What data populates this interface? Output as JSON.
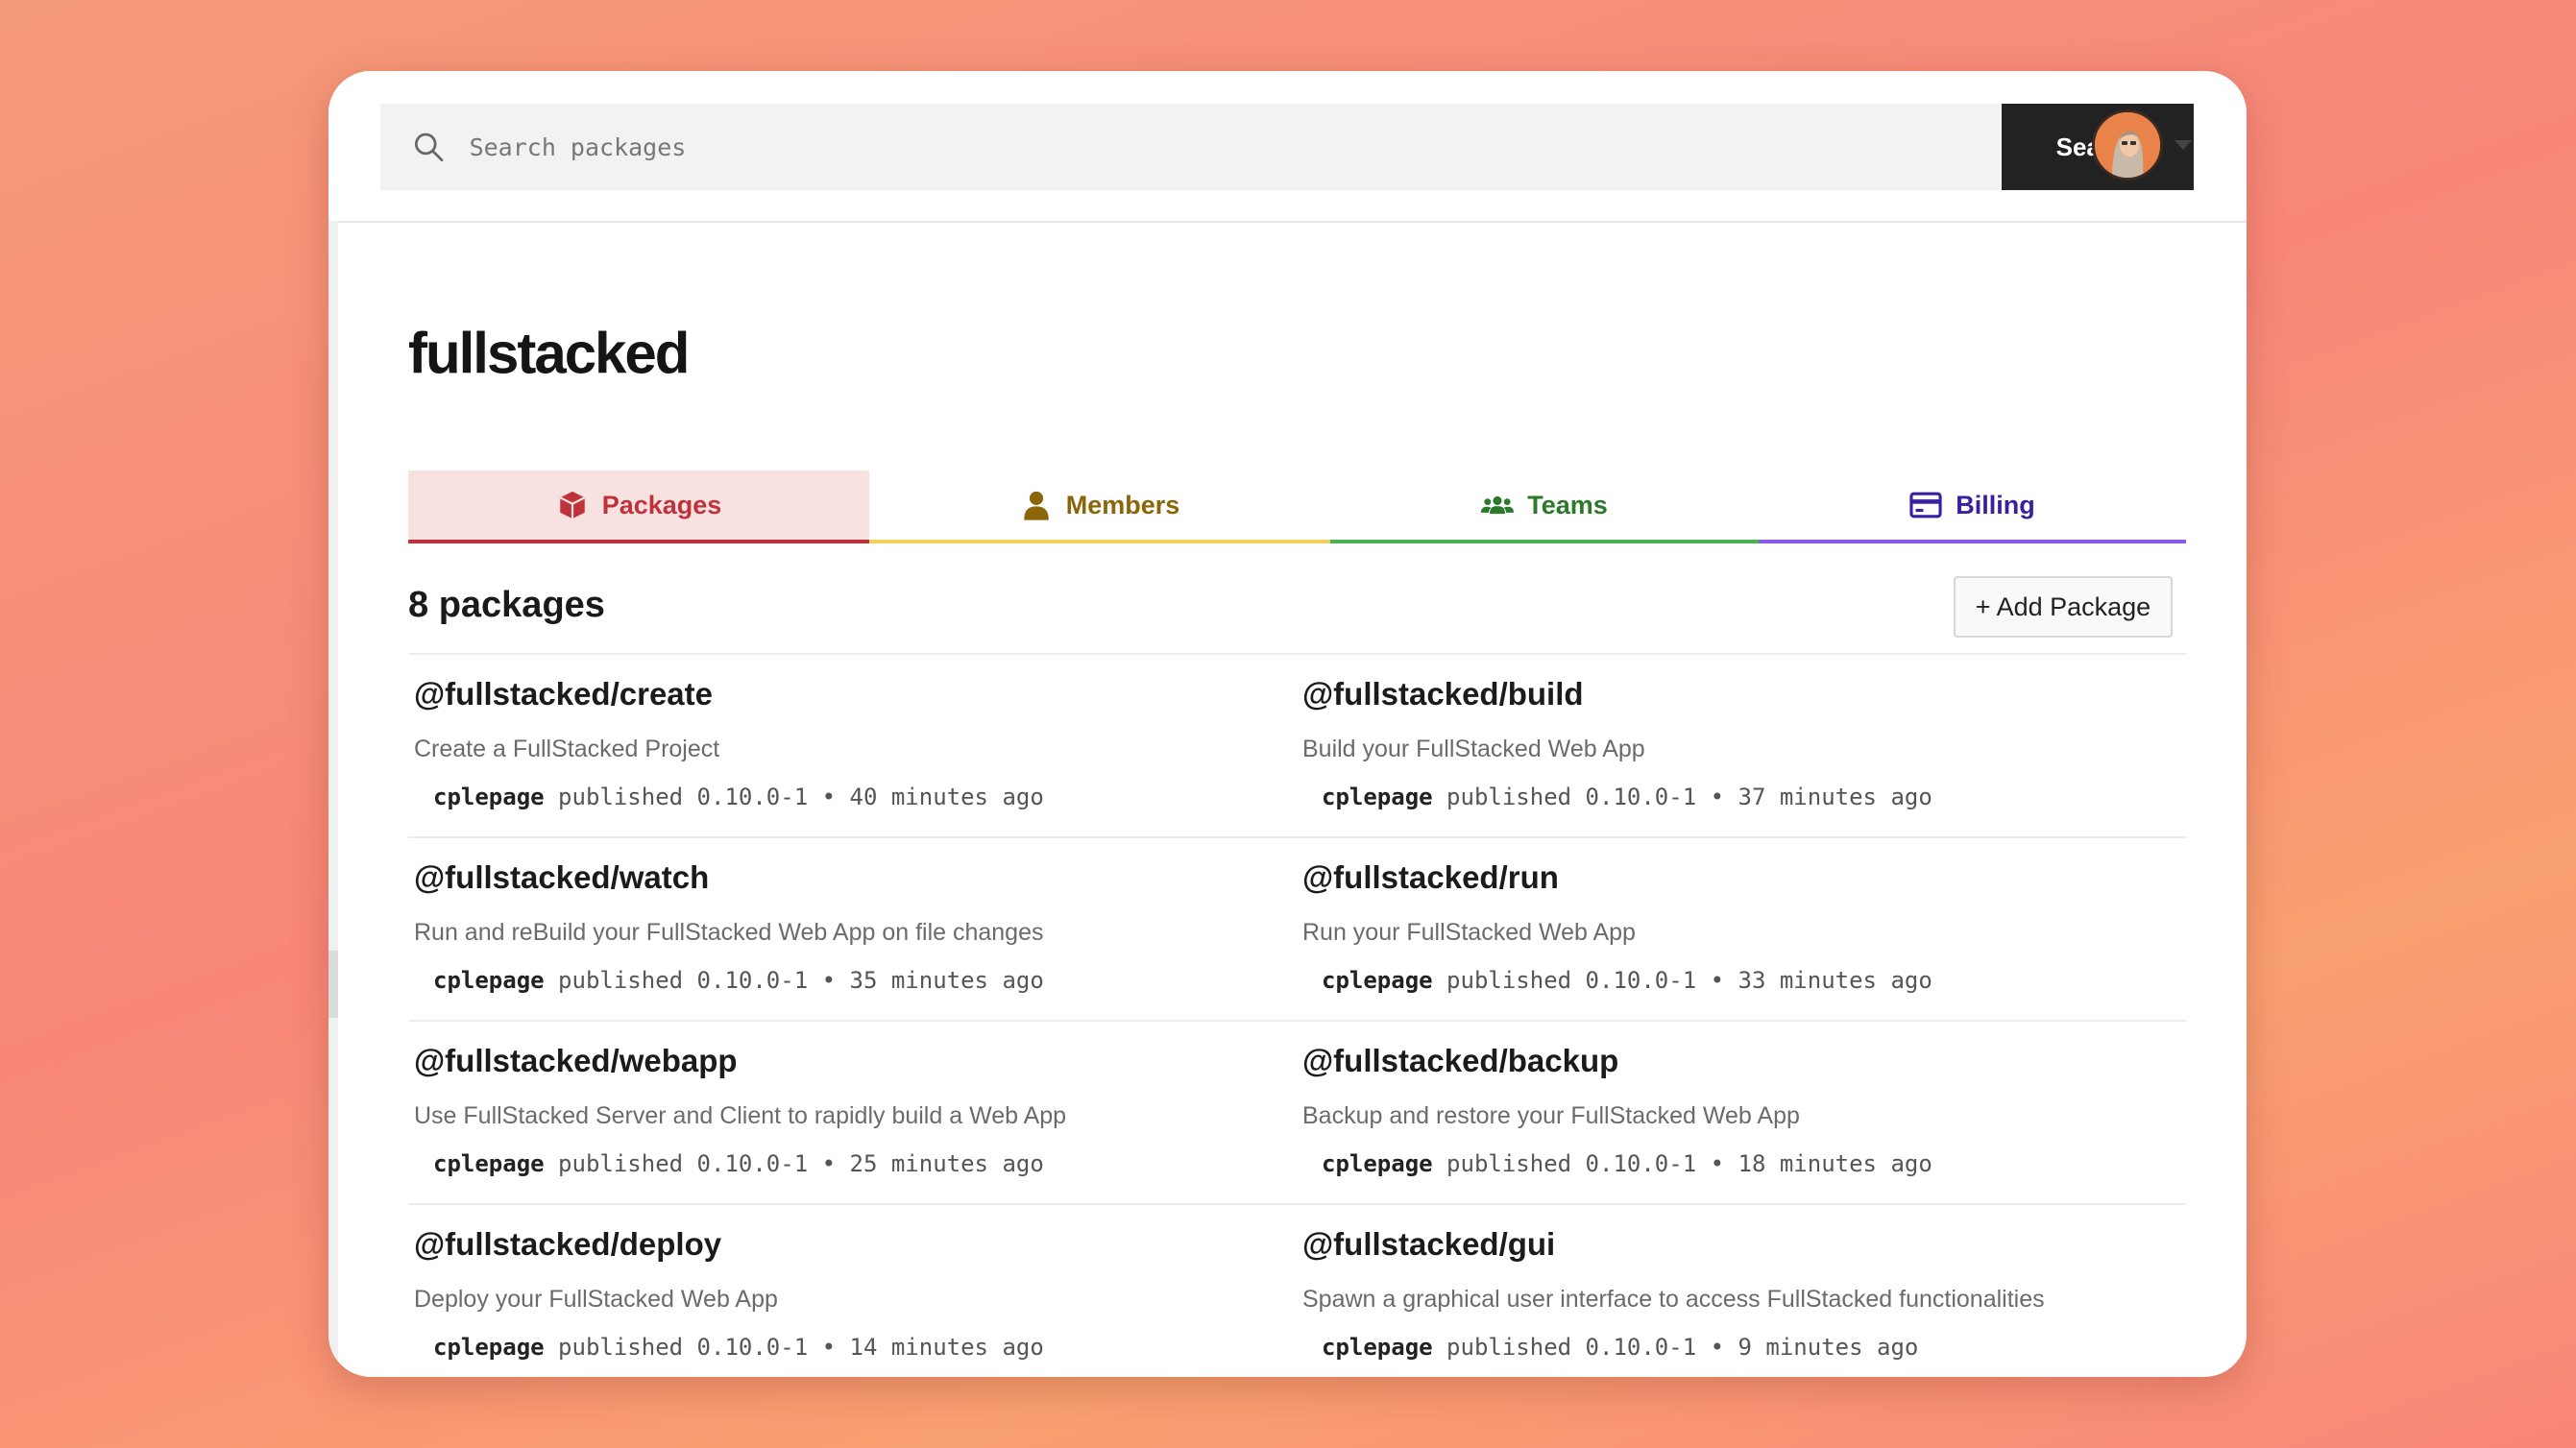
{
  "search": {
    "placeholder": "Search packages",
    "button_label": "Search"
  },
  "org": {
    "name": "fullstacked"
  },
  "tabs": [
    {
      "label": "Packages",
      "icon": "box-icon",
      "color": "#c0323a",
      "active": true
    },
    {
      "label": "Members",
      "icon": "user-icon",
      "color": "#8a6608",
      "active": false
    },
    {
      "label": "Teams",
      "icon": "users-icon",
      "color": "#2a7a2a",
      "active": false
    },
    {
      "label": "Billing",
      "icon": "credit-card-icon",
      "color": "#3a20a0",
      "active": false
    }
  ],
  "packages_header": {
    "count_label": "8 packages",
    "add_button_label": "+ Add Package"
  },
  "packages": [
    {
      "name": "@fullstacked/create",
      "description": "Create a FullStacked Project",
      "author": "cplepage",
      "action": "published",
      "version": "0.10.0-1",
      "time": "40 minutes ago"
    },
    {
      "name": "@fullstacked/build",
      "description": "Build your FullStacked Web App",
      "author": "cplepage",
      "action": "published",
      "version": "0.10.0-1",
      "time": "37 minutes ago"
    },
    {
      "name": "@fullstacked/watch",
      "description": "Run and reBuild your FullStacked Web App on file changes",
      "author": "cplepage",
      "action": "published",
      "version": "0.10.0-1",
      "time": "35 minutes ago"
    },
    {
      "name": "@fullstacked/run",
      "description": "Run your FullStacked Web App",
      "author": "cplepage",
      "action": "published",
      "version": "0.10.0-1",
      "time": "33 minutes ago"
    },
    {
      "name": "@fullstacked/webapp",
      "description": "Use FullStacked Server and Client to rapidly build a Web App",
      "author": "cplepage",
      "action": "published",
      "version": "0.10.0-1",
      "time": "25 minutes ago"
    },
    {
      "name": "@fullstacked/backup",
      "description": "Backup and restore your FullStacked Web App",
      "author": "cplepage",
      "action": "published",
      "version": "0.10.0-1",
      "time": "18 minutes ago"
    },
    {
      "name": "@fullstacked/deploy",
      "description": "Deploy your FullStacked Web App",
      "author": "cplepage",
      "action": "published",
      "version": "0.10.0-1",
      "time": "14 minutes ago"
    },
    {
      "name": "@fullstacked/gui",
      "description": "Spawn a graphical user interface to access FullStacked functionalities",
      "author": "cplepage",
      "action": "published",
      "version": "0.10.0-1",
      "time": "9 minutes ago"
    }
  ],
  "meta_separator": "•",
  "colors": {
    "search_button": "#222222",
    "packages_tab": "#c0323a",
    "members_tab": "#f2d060",
    "teams_tab": "#4caf50",
    "billing_tab": "#8a5ae8"
  }
}
